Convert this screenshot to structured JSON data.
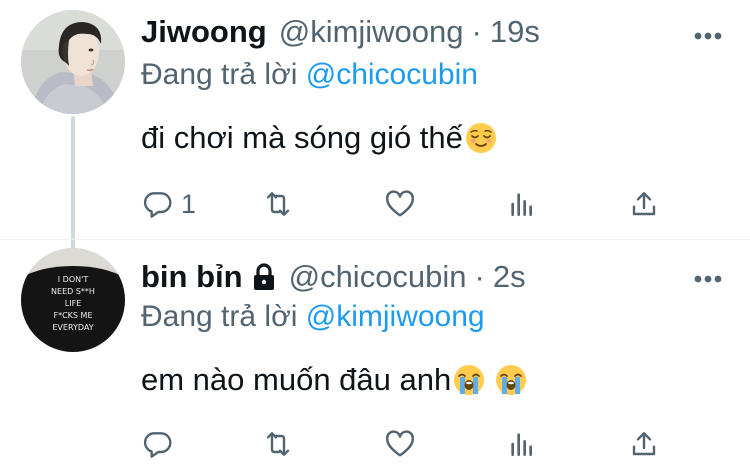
{
  "tweets": [
    {
      "display_name": "Jiwoong",
      "handle": "@kimjiwoong",
      "separator": "·",
      "time": "19s",
      "replying_prefix": "Đang trả lời ",
      "replying_to": "@chicocubin",
      "text": "đi chơi mà sóng gió thế",
      "emoji": [
        "relieved-face"
      ],
      "reply_count": "1",
      "locked": false
    },
    {
      "display_name": "bin bỉn",
      "handle": "@chicocubin",
      "separator": "·",
      "time": "2s",
      "replying_prefix": "Đang trả lời ",
      "replying_to": "@kimjiwoong",
      "text": "em nào muốn đâu anh",
      "emoji": [
        "loudly-crying-face",
        "loudly-crying-face"
      ],
      "reply_count": "",
      "locked": true,
      "avatar_shirt_text": [
        "I DON'T",
        "NEED S**H",
        "LIFE",
        "F*CKS ME",
        "EVERYDAY"
      ]
    }
  ],
  "colors": {
    "text": "#0f1419",
    "secondary": "#536471",
    "link": "#1d9bf0",
    "thread_line": "#cfd9de"
  }
}
